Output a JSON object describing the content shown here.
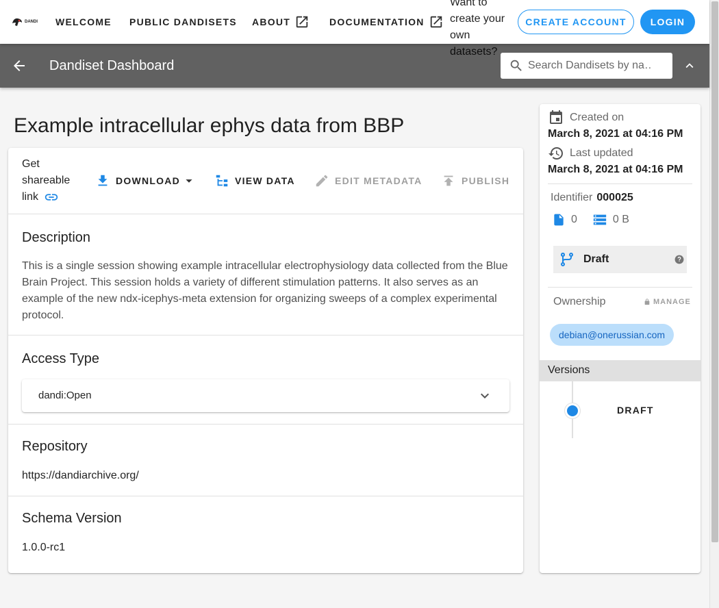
{
  "nav": {
    "logo_text": "DANDI",
    "links": [
      "WELCOME",
      "PUBLIC DANDISETS",
      "ABOUT",
      "DOCUMENTATION"
    ],
    "cta_text": "Want to create your own datasets?",
    "create_account": "CREATE ACCOUNT",
    "login": "LOGIN"
  },
  "subbar": {
    "title": "Dandiset Dashboard",
    "search_placeholder": "Search Dandisets by na…"
  },
  "dandiset": {
    "title": "Example intracellular ephys data from BBP"
  },
  "toolbar": {
    "share_text": "Get shareable link",
    "download": "DOWNLOAD",
    "view_data": "VIEW DATA",
    "edit_metadata": "EDIT METADATA",
    "publish": "PUBLISH"
  },
  "sections": {
    "description_title": "Description",
    "description": "This is a single session showing example intracellular electrophysiology data collected from the Blue Brain Project. This session holds a variety of different stimulation patterns. It also serves as an example of the new ndx-icephys-meta extension for organizing sweeps of a complex experimental protocol.",
    "access_title": "Access Type",
    "access_value": "dandi:Open",
    "repository_title": "Repository",
    "repository_value": "https://dandiarchive.org/",
    "schema_title": "Schema Version",
    "schema_value": "1.0.0-rc1"
  },
  "side": {
    "created_label": "Created on",
    "created_date": "March 8, 2021 at 04:16 PM",
    "updated_label": "Last updated",
    "updated_date": "March 8, 2021 at 04:16 PM",
    "identifier_label": "Identifier",
    "identifier": "000025",
    "file_count": "0",
    "size": "0 B",
    "status": "Draft",
    "ownership_label": "Ownership",
    "manage": "MANAGE",
    "owner": "debian@onerussian.com",
    "versions_label": "Versions",
    "version": "DRAFT"
  },
  "colors": {
    "accent": "#2196f3",
    "subbar": "#616161",
    "chip": "#bbdefb"
  }
}
